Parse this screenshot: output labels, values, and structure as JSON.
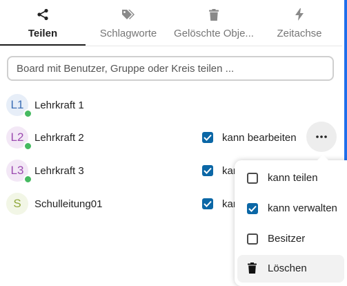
{
  "tabs": [
    {
      "label": "Teilen",
      "icon": "share-icon",
      "active": true
    },
    {
      "label": "Schlagworte",
      "icon": "tag-icon",
      "active": false
    },
    {
      "label": "Gelöschte Obje...",
      "icon": "trash-icon",
      "active": false
    },
    {
      "label": "Zeitachse",
      "icon": "lightning-icon",
      "active": false
    }
  ],
  "search": {
    "placeholder": "Board mit Benutzer, Gruppe oder Kreis teilen ..."
  },
  "users": [
    {
      "initials": "L1",
      "name": "Lehrkraft 1",
      "avatar_bg": "#e7eef8",
      "avatar_fg": "#3d6fb6",
      "status": true,
      "permission": ""
    },
    {
      "initials": "L2",
      "name": "Lehrkraft 2",
      "avatar_bg": "#f3e8f6",
      "avatar_fg": "#9c4bb0",
      "status": true,
      "permission": "kann bearbeiten"
    },
    {
      "initials": "L3",
      "name": "Lehrkraft 3",
      "avatar_bg": "#f3e8f6",
      "avatar_fg": "#9c4bb0",
      "status": true,
      "permission": "kann bearbeiten"
    },
    {
      "initials": "S",
      "name": "Schulleitung01",
      "avatar_bg": "#f2f6e6",
      "avatar_fg": "#8fa73a",
      "status": false,
      "permission": "kann bearbeiten"
    }
  ],
  "menu": {
    "items": [
      {
        "label": "kann teilen",
        "checked": false
      },
      {
        "label": "kann verwalten",
        "checked": true
      },
      {
        "label": "Besitzer",
        "checked": false
      }
    ],
    "delete_label": "Löschen"
  },
  "colors": {
    "accent": "#0b67a6",
    "scrollbar": "#1f6feb",
    "status": "#46ba61"
  }
}
